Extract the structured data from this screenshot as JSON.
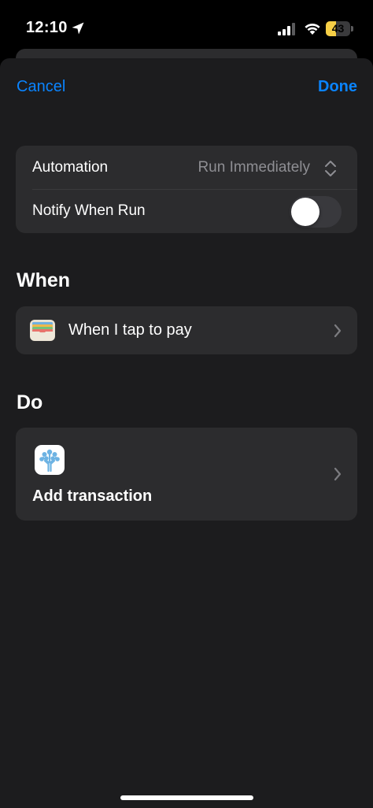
{
  "status_bar": {
    "time": "12:10",
    "battery_level": "43",
    "battery_fraction": 0.43,
    "battery_color": "#f7cf46",
    "icons": [
      "location-arrow-icon",
      "cellular-signal-icon",
      "wifi-icon",
      "battery-icon"
    ]
  },
  "nav": {
    "cancel_label": "Cancel",
    "done_label": "Done",
    "accent_color": "#0a84ff"
  },
  "settings": {
    "automation_label": "Automation",
    "automation_value": "Run Immediately",
    "notify_label": "Notify When Run",
    "notify_enabled": false
  },
  "when": {
    "section_title": "When",
    "trigger_label": "When I tap to pay",
    "trigger_icon": "wallet-icon"
  },
  "do": {
    "section_title": "Do",
    "action_label": "Add transaction",
    "action_icon": "tree-app-icon"
  }
}
